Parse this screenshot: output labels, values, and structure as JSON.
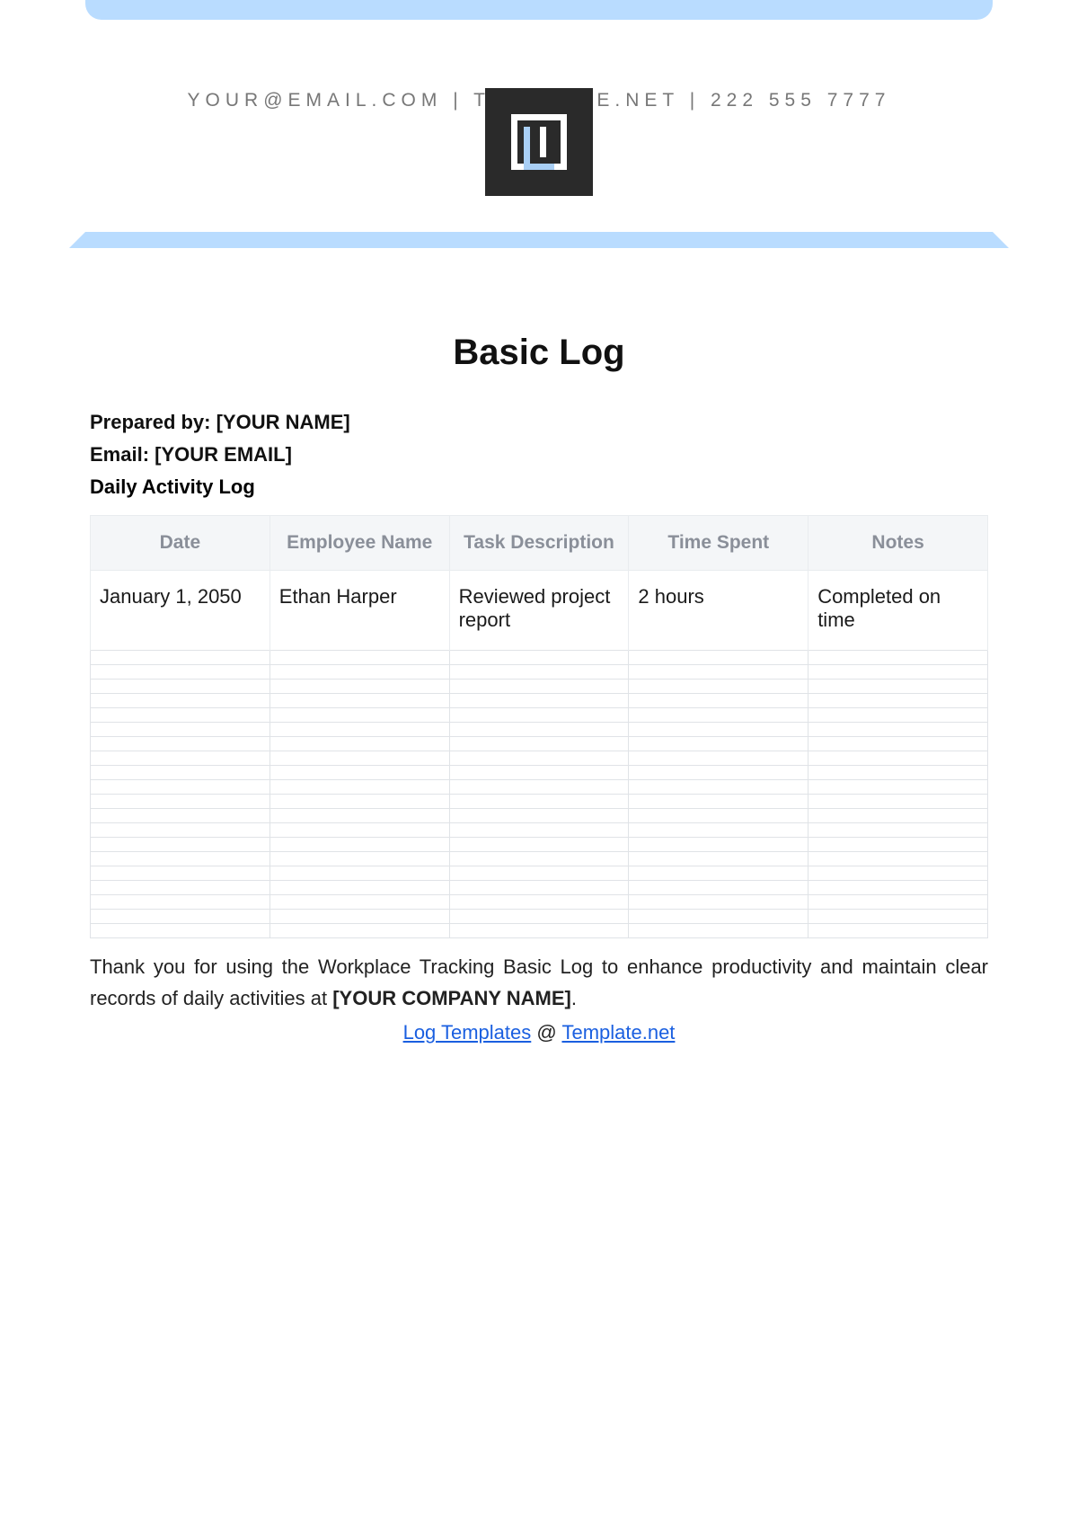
{
  "header": {
    "contact_line": "YOUR@EMAIL.COM | TEMPLATE.NET | 222 555 7777"
  },
  "title": "Basic Log",
  "meta": {
    "prepared_label": "Prepared by: ",
    "prepared_value": "[YOUR NAME]",
    "email_label": "Email: ",
    "email_value": "[YOUR EMAIL]",
    "section_title": "Daily Activity Log"
  },
  "table": {
    "headers": [
      "Date",
      "Employee Name",
      "Task Description",
      "Time Spent",
      "Notes"
    ],
    "row": {
      "date": "January 1, 2050",
      "employee": "Ethan Harper",
      "task": "Reviewed project report",
      "time": "2 hours",
      "notes": "Completed on time"
    },
    "empty_rows": 20
  },
  "footer": {
    "text_before": "Thank you for using the Workplace Tracking Basic Log to enhance productivity and maintain clear records of daily activities at ",
    "company": "[YOUR COMPANY NAME]",
    "text_after": "."
  },
  "credit": {
    "link1_text": "Log Templates",
    "middle": " @ ",
    "link2_text": "Template.net"
  }
}
